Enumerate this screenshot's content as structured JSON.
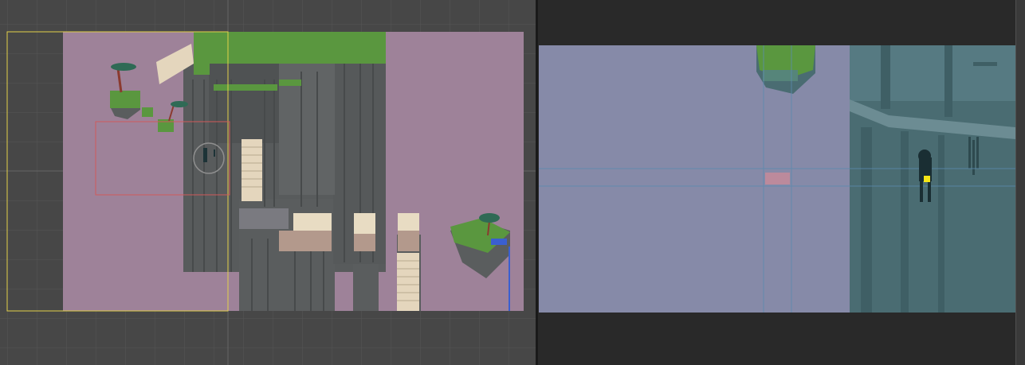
{
  "scene_view": {
    "label": "",
    "background": "#474747",
    "level_bg_color": "#9e8299",
    "grass_color": "#5a973f",
    "rock_color": "#5a5d5e",
    "camera_bounds_color": "#e3d04a",
    "camera_view_color": "#d05a5a",
    "stairs_color": "#e8dcc3"
  },
  "game_view": {
    "label": "",
    "sky_color": "#868aa8",
    "cliff_color": "#4a6c72",
    "player_marker_color": "#f5e617",
    "guide_line_color": "#5a8bb0"
  }
}
